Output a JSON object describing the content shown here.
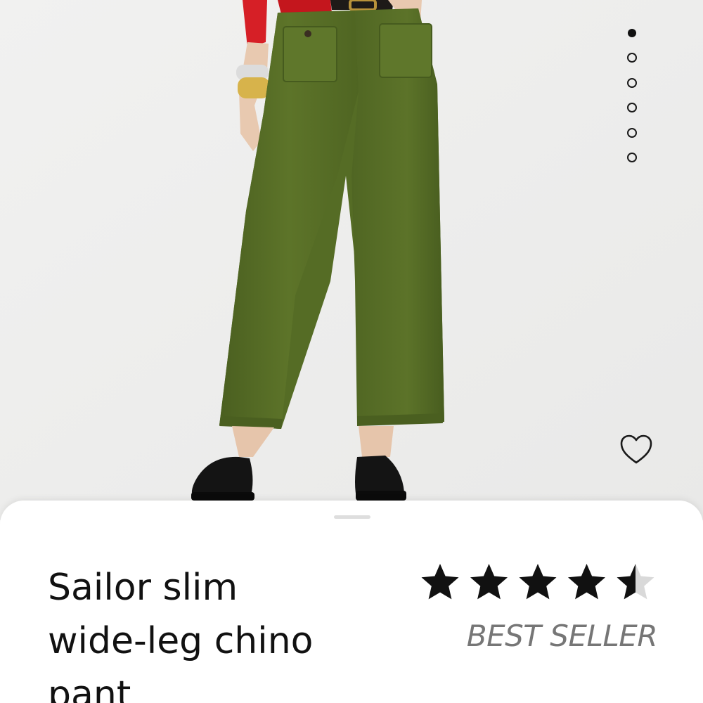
{
  "product": {
    "title_line1": "Sailor slim",
    "title_line2": "wide-leg chino",
    "title_line3": "pant",
    "badge": "BEST SELLER",
    "rating": 4.5,
    "color": "#5a7028",
    "favorite_icon": "heart-outline-icon"
  },
  "gallery": {
    "image_count": 6,
    "active_index": 0
  },
  "colors": {
    "background": "#efefee",
    "star_filled": "#111111",
    "star_empty": "#d9d9d9",
    "badge_text": "#767676"
  }
}
